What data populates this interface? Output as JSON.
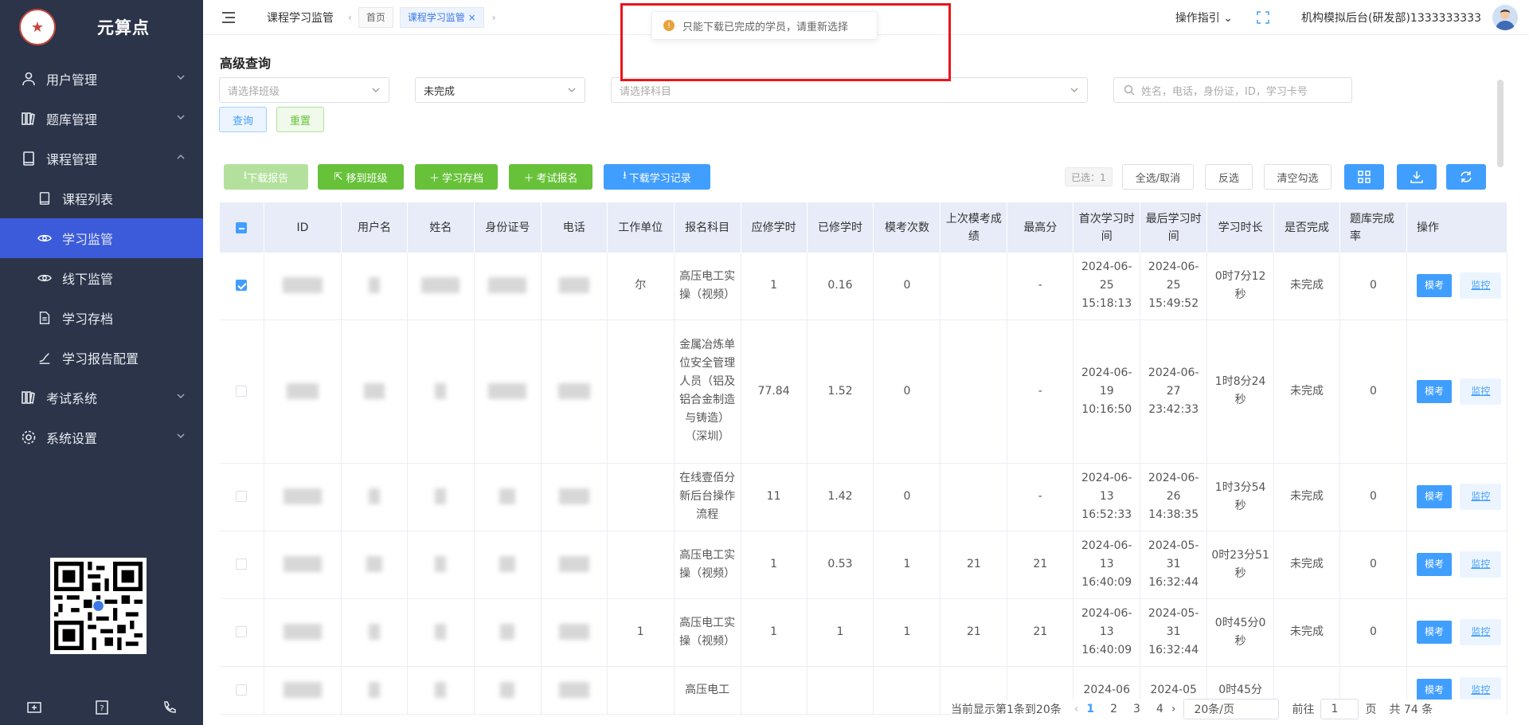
{
  "sidebar": {
    "brand": "元算点",
    "items": [
      {
        "label": "用户管理",
        "icon": "users-icon"
      },
      {
        "label": "题库管理",
        "icon": "library-icon"
      },
      {
        "label": "课程管理",
        "icon": "book-icon"
      },
      {
        "label": "课程列表",
        "icon": "book-icon"
      },
      {
        "label": "学习监管",
        "icon": "eye-icon"
      },
      {
        "label": "线下监管",
        "icon": "eye-icon"
      },
      {
        "label": "学习存档",
        "icon": "document-icon"
      },
      {
        "label": "学习报告配置",
        "icon": "config-icon"
      },
      {
        "label": "考试系统",
        "icon": "library-icon"
      },
      {
        "label": "系统设置",
        "icon": "gear-icon"
      }
    ]
  },
  "topbar": {
    "title": "课程学习监管",
    "tabs": [
      "首页",
      "课程学习监管"
    ],
    "guide": "操作指引",
    "org": "机构模拟后台(研发部)1333333333"
  },
  "toast": "只能下载已完成的学员，请重新选择",
  "filters": {
    "title": "高级查询",
    "class_placeholder": "请选择班级",
    "status_value": "未完成",
    "subject_placeholder": "请选择科目",
    "search_placeholder": "姓名，电话，身份证，ID，学习卡号",
    "query": "查询",
    "reset": "重置"
  },
  "toolbar": {
    "download_report": "下载报告",
    "move_class": "移到班级",
    "archive": "学习存档",
    "exam_signup": "考试报名",
    "download_records": "下载学习记录",
    "selected": "已选：1",
    "select_all": "全选/取消",
    "invert": "反选",
    "clear": "清空勾选"
  },
  "table": {
    "headers": [
      "ID",
      "用户名",
      "姓名",
      "身份证号",
      "电话",
      "工作单位",
      "报名科目",
      "应修学时",
      "已修学时",
      "模考次数",
      "上次模考成绩",
      "最高分",
      "首次学习时间",
      "最后学习时间",
      "学习时长",
      "是否完成",
      "题库完成率",
      "操作"
    ],
    "mock_label": "模考",
    "monitor_label": "监控",
    "rows": [
      {
        "checked": true,
        "id": "",
        "unit": "尔",
        "subject": "高压电工实操（视频）",
        "req": "1",
        "done": "0.16",
        "mocks": "0",
        "last": "",
        "max": "-",
        "first": "2024-06-25 15:18:13",
        "latest": "2024-06-25 15:49:52",
        "dur": "0时7分12秒",
        "complete": "未完成",
        "rate": "0"
      },
      {
        "checked": false,
        "id": "",
        "unit": "",
        "subject": "金属冶炼单位安全管理人员（铝及铝合金制造与铸造）（深圳）",
        "req": "77.84",
        "done": "1.52",
        "mocks": "0",
        "last": "",
        "max": "-",
        "first": "2024-06-19 10:16:50",
        "latest": "2024-06-27 23:42:33",
        "dur": "1时8分24秒",
        "complete": "未完成",
        "rate": "0"
      },
      {
        "checked": false,
        "id": "",
        "unit": "",
        "subject": "在线壹佰分新后台操作流程",
        "req": "11",
        "done": "1.42",
        "mocks": "0",
        "last": "",
        "max": "-",
        "first": "2024-06-13 16:52:33",
        "latest": "2024-06-26 14:38:35",
        "dur": "1时3分54秒",
        "complete": "未完成",
        "rate": "0"
      },
      {
        "checked": false,
        "id": "",
        "unit": "",
        "subject": "高压电工实操（视频）",
        "req": "1",
        "done": "0.53",
        "mocks": "1",
        "last": "21",
        "max": "21",
        "first": "2024-06-13 16:40:09",
        "latest": "2024-05-31 16:32:44",
        "dur": "0时23分51秒",
        "complete": "未完成",
        "rate": "0"
      },
      {
        "checked": false,
        "id": "",
        "unit": "1",
        "subject": "高压电工实操（视频）",
        "req": "1",
        "done": "1",
        "mocks": "1",
        "last": "21",
        "max": "21",
        "first": "2024-06-13 16:40:09",
        "latest": "2024-05-31 16:32:44",
        "dur": "0时45分0秒",
        "complete": "未完成",
        "rate": "0"
      },
      {
        "checked": false,
        "id": "",
        "unit": "",
        "subject": "高压电工",
        "req": "",
        "done": "",
        "mocks": "",
        "last": "",
        "max": "",
        "first": "2024-06",
        "latest": "2024-05",
        "dur": "0时45分",
        "complete": "",
        "rate": ""
      }
    ]
  },
  "pager": {
    "info": "当前显示第1条到20条",
    "pages": [
      "1",
      "2",
      "3",
      "4"
    ],
    "size": "20条/页",
    "goto": "前往",
    "page_input": "1",
    "page_unit": "页",
    "total": "共 74 条"
  }
}
